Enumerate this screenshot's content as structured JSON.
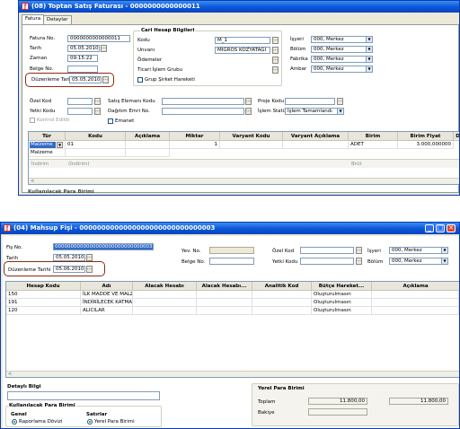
{
  "win1": {
    "title": "(08) Toptan Satış Faturası - 0000000000000011",
    "tabs": [
      "Fatura",
      "Detaylar"
    ],
    "fatura_no_label": "Fatura No.",
    "fatura_no_value": "0000000000000011",
    "tarih_label": "Tarih",
    "tarih_value": "05.05.2010",
    "zaman_label": "Zaman",
    "zaman_value": "09:15:22",
    "belge_no_label": "Belge No.",
    "duzenleme_label": "Düzenleme Tarihi",
    "duzenleme_value": "05.05.2010",
    "cari_title": "Cari Hesap Bilgileri",
    "kodu_label": "Kodu",
    "kodu_value": "M_1",
    "unvani_label": "Unvanı",
    "unvani_value": "MİGROS KOZYATAĞI",
    "odemeler_label": "Ödemeler",
    "ticari_label": "Ticari İşlem Grubu",
    "grup_label": "Grup Şirket Hareketi",
    "isyeri_label": "İşyeri",
    "isyeri_value": "000, Merkez",
    "bolum_label": "Bölüm",
    "bolum_value": "000, Merkez",
    "fabrika_label": "Fabrika",
    "fabrika_value": "000, Merkez",
    "ambar_label": "Ambar",
    "ambar_value": "000, Merkez",
    "ozel_kod_label": "Özel Kod",
    "yetki_kodu_label": "Yetki Kodu",
    "kontrol_label": "Kontrol Edildi",
    "satis_eleman_label": "Satış Elemanı Kodu",
    "dagitim_label": "Dağıtım Emri No.",
    "emanet_label": "Emanet",
    "proje_label": "Proje Kodu",
    "islem_statusu_label": "İşlem Statüsü",
    "islem_statusu_value": "İşlem Tamamlandı",
    "columns": [
      "Tür",
      "Kodu",
      "Açıklama",
      "Miktar",
      "Varyant Kodu",
      "Varyant Açıklama",
      "Birim",
      "Birim Fiyat",
      "D"
    ],
    "row1": {
      "tur": "Malzeme",
      "kodu": "01",
      "miktar": "1",
      "birim": "ADET",
      "fiyat": "3.000,000000"
    },
    "row2": {
      "tur": "Malzeme"
    },
    "footer": {
      "indirim1": "İndirim",
      "indirim2": "(İndirim)",
      "brut": "Brüt"
    },
    "bottom_label": "Kullanılacak Para Birimi"
  },
  "win2": {
    "title": "(04) Mahsup Fişi - 0000000000000000000000000000003",
    "fis_no_label": "Fiş No.",
    "fis_no_value": "0000000000000000000000000000003",
    "tarih_label": "Tarih",
    "tarih_value": "05.05.2010",
    "duzenleme_label": "Düzenleme Tarihi",
    "duzenleme_value": "05.06.2010",
    "yev_no_label": "Yev. No.",
    "belge_no_label": "Belge No.",
    "ozel_kod_label": "Özel Kod",
    "yetki_kodu_label": "Yetki Kodu",
    "isyeri_label": "İşyeri",
    "isyeri_value": "000, Merkez",
    "bolum_label": "Bölüm",
    "bolum_value": "000, Merkez",
    "columns": [
      "Hesap Kodu",
      "Adı",
      "Alacak Hesabı",
      "Alacak Hesabı...",
      "Analitik Kod",
      "Bütçe Hareket...",
      "Açıklama"
    ],
    "rows": [
      {
        "kod": "150",
        "adi": "İLK MADDE VE MALZ",
        "butce": "Oluşturulmasın"
      },
      {
        "kod": "191",
        "adi": "İNDİRİLECEK KATMA",
        "butce": "Oluşturulmasın"
      },
      {
        "kod": "120",
        "adi": "ALICILAR",
        "butce": "Oluşturulmasın"
      }
    ],
    "detayli_label": "Detaylı Bilgi",
    "kullanilacak_label": "Kullanılacak Para Birimi",
    "genel_label": "Genel",
    "satirlar_label": "Satırlar",
    "raporlama_label": "Raporlama Dövizi",
    "yerel_pb_label": "Yerel Para Birimi",
    "yerel_title": "Yerel Para Birimi",
    "toplam_label": "Toplam",
    "toplam_borc": "11.800,00",
    "toplam_alacak": "11.800,00",
    "bakiye_label": "Bakiye"
  }
}
